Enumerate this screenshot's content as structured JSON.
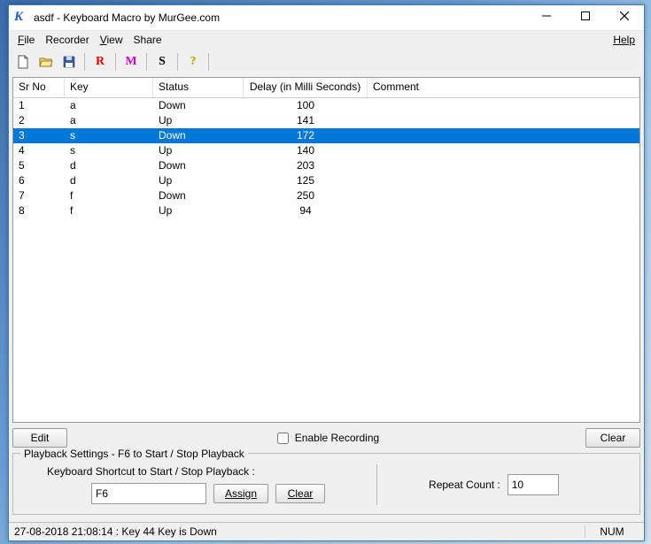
{
  "title": "asdf - Keyboard Macro by MurGee.com",
  "menu": {
    "file": "File",
    "recorder": "Recorder",
    "view": "View",
    "share": "Share",
    "help": "Help"
  },
  "columns": {
    "sr": "Sr No",
    "key": "Key",
    "status": "Status",
    "delay": "Delay (in Milli Seconds)",
    "comment": "Comment"
  },
  "rows": [
    {
      "sr": "1",
      "key": "a",
      "status": "Down",
      "delay": "100",
      "comment": "",
      "selected": false
    },
    {
      "sr": "2",
      "key": "a",
      "status": "Up",
      "delay": "141",
      "comment": "",
      "selected": false
    },
    {
      "sr": "3",
      "key": "s",
      "status": "Down",
      "delay": "172",
      "comment": "",
      "selected": true
    },
    {
      "sr": "4",
      "key": "s",
      "status": "Up",
      "delay": "140",
      "comment": "",
      "selected": false
    },
    {
      "sr": "5",
      "key": "d",
      "status": "Down",
      "delay": "203",
      "comment": "",
      "selected": false
    },
    {
      "sr": "6",
      "key": "d",
      "status": "Up",
      "delay": "125",
      "comment": "",
      "selected": false
    },
    {
      "sr": "7",
      "key": "f",
      "status": "Down",
      "delay": "250",
      "comment": "",
      "selected": false
    },
    {
      "sr": "8",
      "key": "f",
      "status": "Up",
      "delay": "94",
      "comment": "",
      "selected": false
    }
  ],
  "buttons": {
    "edit": "Edit",
    "clear_top": "Clear",
    "enable_recording": "Enable Recording",
    "assign": "Assign",
    "clear_pb": "Clear"
  },
  "playback": {
    "legend": "Playback Settings - F6 to Start / Stop Playback",
    "shortcut_label": "Keyboard Shortcut to Start / Stop Playback :",
    "shortcut_value": "F6",
    "repeat_label": "Repeat Count :",
    "repeat_value": "10"
  },
  "status": {
    "text": "27-08-2018 21:08:14 : Key 44 Key is Down",
    "num": "NUM"
  }
}
